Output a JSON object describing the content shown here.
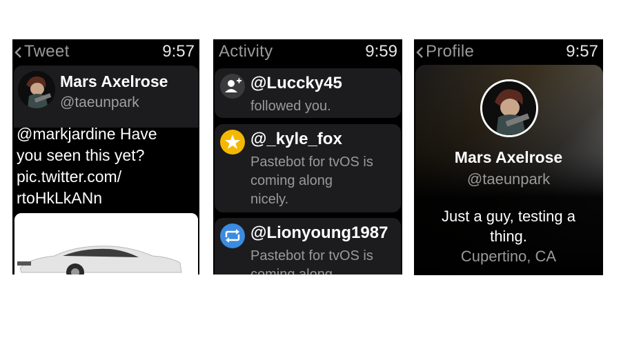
{
  "tweet_screen": {
    "back_title": "Tweet",
    "time": "9:57",
    "author_name": "Mars Axelrose",
    "author_handle": "@taeunpark",
    "text_lines": [
      "@markjardine Have",
      "you seen this yet?",
      "pic.twitter.com/",
      "rtoHkLkANn"
    ]
  },
  "activity_screen": {
    "title": "Activity",
    "time": "9:59",
    "items": [
      {
        "icon": "person-add-icon",
        "icon_color": "#3a3a3c",
        "name": "@Luccky45",
        "lines": [
          "followed you."
        ]
      },
      {
        "icon": "star-icon",
        "icon_color": "#f5b800",
        "name": "@_kyle_fox",
        "lines": [
          "Pastebot for tvOS is",
          "coming along",
          "nicely."
        ]
      },
      {
        "icon": "retweet-icon",
        "icon_color": "#3b8be0",
        "name": "@Lionyoung1987",
        "lines": [
          "Pastebot for tvOS is",
          "coming along"
        ]
      }
    ]
  },
  "profile_screen": {
    "back_title": "Profile",
    "time": "9:57",
    "name": "Mars Axelrose",
    "handle": "@taeunpark",
    "bio_lines": [
      "Just a guy, testing a",
      "thing."
    ],
    "location": "Cupertino, CA"
  }
}
